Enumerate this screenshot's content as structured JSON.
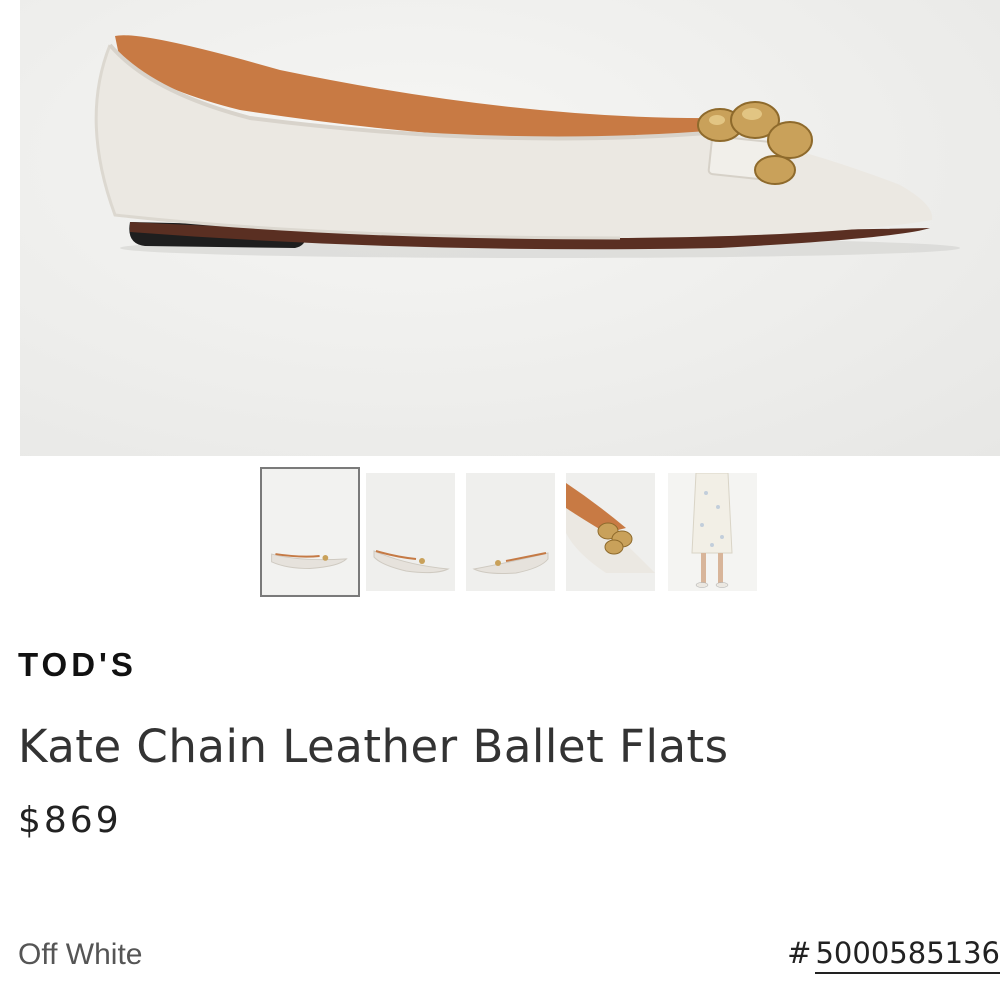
{
  "product": {
    "brand": "TOD'S",
    "title": "Kate Chain Leather Ballet Flats",
    "price": "$869",
    "color": "Off White",
    "sku_prefix": "#",
    "sku": "5000585136"
  },
  "gallery": {
    "main_image": "shoe-side-view",
    "thumbnails": [
      {
        "name": "thumb-side-view-1",
        "selected": true
      },
      {
        "name": "thumb-side-view-2",
        "selected": false
      },
      {
        "name": "thumb-side-view-3",
        "selected": false
      },
      {
        "name": "thumb-detail-closeup",
        "selected": false
      },
      {
        "name": "thumb-model-wearing",
        "selected": false
      }
    ]
  },
  "colors": {
    "leather": "#ebe8e2",
    "lining": "#c57a45",
    "hardware": "#c9a15a",
    "sole": "#2a2a2a"
  }
}
